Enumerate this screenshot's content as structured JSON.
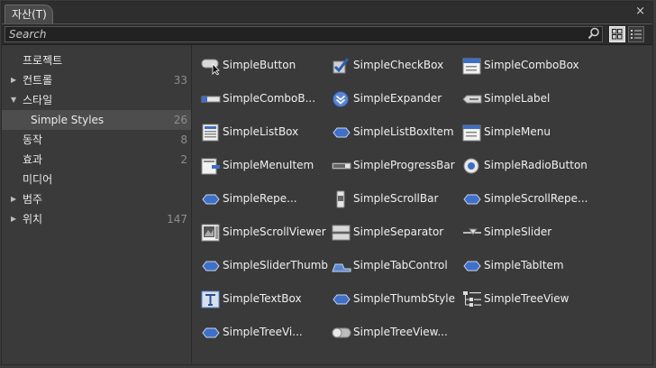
{
  "tab": {
    "title": "자산(T)"
  },
  "close_label": "×",
  "search": {
    "placeholder": "Search"
  },
  "sidebar": {
    "items": [
      {
        "label": "프로젝트",
        "count": "",
        "arrow": ""
      },
      {
        "label": "컨트롤",
        "count": "33",
        "arrow": "▶"
      },
      {
        "label": "스타일",
        "count": "",
        "arrow": "▼"
      },
      {
        "label": "Simple Styles",
        "count": "26",
        "arrow": ""
      },
      {
        "label": "동작",
        "count": "8",
        "arrow": ""
      },
      {
        "label": "효과",
        "count": "2",
        "arrow": ""
      },
      {
        "label": "미디어",
        "count": "",
        "arrow": ""
      },
      {
        "label": "범주",
        "count": "",
        "arrow": "▶"
      },
      {
        "label": "위치",
        "count": "147",
        "arrow": "▶"
      }
    ]
  },
  "assets": [
    {
      "name": "SimpleButton",
      "icon": "button-icon"
    },
    {
      "name": "SimpleCheckBox",
      "icon": "checkbox-icon"
    },
    {
      "name": "SimpleComboBox",
      "icon": "combobox-icon"
    },
    {
      "name": "SimpleComboB...",
      "icon": "comboboxitem-icon"
    },
    {
      "name": "SimpleExpander",
      "icon": "expander-icon"
    },
    {
      "name": "SimpleLabel",
      "icon": "label-icon"
    },
    {
      "name": "SimpleListBox",
      "icon": "listbox-icon"
    },
    {
      "name": "SimpleListBoxItem",
      "icon": "style-icon"
    },
    {
      "name": "SimpleMenu",
      "icon": "menu-icon"
    },
    {
      "name": "SimpleMenuItem",
      "icon": "menuitem-icon"
    },
    {
      "name": "SimpleProgressBar",
      "icon": "progressbar-icon"
    },
    {
      "name": "SimpleRadioButton",
      "icon": "radiobutton-icon"
    },
    {
      "name": "SimpleRepe...",
      "icon": "style-icon"
    },
    {
      "name": "SimpleScrollBar",
      "icon": "scrollbar-icon"
    },
    {
      "name": "SimpleScrollRepe...",
      "icon": "style-icon"
    },
    {
      "name": "SimpleScrollViewer",
      "icon": "scrollviewer-icon"
    },
    {
      "name": "SimpleSeparator",
      "icon": "separator-icon"
    },
    {
      "name": "SimpleSlider",
      "icon": "slider-icon"
    },
    {
      "name": "SimpleSliderThumb",
      "icon": "style-icon"
    },
    {
      "name": "SimpleTabControl",
      "icon": "tabcontrol-icon"
    },
    {
      "name": "SimpleTabItem",
      "icon": "style-icon"
    },
    {
      "name": "SimpleTextBox",
      "icon": "textbox-icon"
    },
    {
      "name": "SimpleThumbStyle",
      "icon": "style-icon"
    },
    {
      "name": "SimpleTreeView",
      "icon": "treeview-icon"
    },
    {
      "name": "SimpleTreeVi...",
      "icon": "style-icon"
    },
    {
      "name": "SimpleTreeView...",
      "icon": "toggle-icon"
    }
  ]
}
